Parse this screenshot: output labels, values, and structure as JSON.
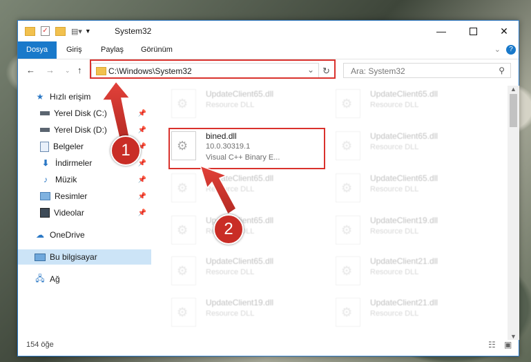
{
  "window": {
    "title": "System32"
  },
  "ribbon": {
    "tabs": [
      "Dosya",
      "Giriş",
      "Paylaş",
      "Görünüm"
    ]
  },
  "address": {
    "path": "C:\\Windows\\System32"
  },
  "search": {
    "placeholder": "Ara: System32"
  },
  "sidebar": {
    "items": [
      {
        "label": "Hızlı erişim",
        "icon": "star-icon"
      },
      {
        "label": "Yerel Disk (C:)",
        "icon": "drive-icon",
        "pinned": true
      },
      {
        "label": "Yerel Disk (D:)",
        "icon": "drive-icon",
        "pinned": true
      },
      {
        "label": "Belgeler",
        "icon": "documents-icon",
        "pinned": true
      },
      {
        "label": "İndirmeler",
        "icon": "download-icon",
        "pinned": true
      },
      {
        "label": "Müzik",
        "icon": "music-icon",
        "pinned": true
      },
      {
        "label": "Resimler",
        "icon": "pictures-icon",
        "pinned": true
      },
      {
        "label": "Videolar",
        "icon": "videos-icon",
        "pinned": true
      },
      {
        "label": "OneDrive",
        "icon": "cloud-icon"
      },
      {
        "label": "Bu bilgisayar",
        "icon": "computer-icon",
        "selected": true
      },
      {
        "label": "Ağ",
        "icon": "network-icon"
      }
    ]
  },
  "files": {
    "left": [
      {
        "name": "UpdateClient65.dll",
        "type": "Resource DLL"
      },
      {
        "name": "bined.dll",
        "version": "10.0.30319.1",
        "type": "Visual C++ Binary E..."
      },
      {
        "name": "UpdateClient65.dll",
        "type": "Resource DLL"
      },
      {
        "name": "UpdateClient65.dll",
        "type": "Resource DLL"
      },
      {
        "name": "UpdateClient65.dll",
        "type": "Resource DLL"
      },
      {
        "name": "UpdateClient19.dll",
        "type": "Resource DLL"
      }
    ],
    "right": [
      {
        "name": "UpdateClient65.dll",
        "type": "Resource DLL"
      },
      {
        "name": "UpdateClient65.dll",
        "type": "Resource DLL"
      },
      {
        "name": "UpdateClient65.dll",
        "type": "Resource DLL"
      },
      {
        "name": "UpdateClient19.dll",
        "type": "Resource DLL"
      },
      {
        "name": "UpdateClient21.dll",
        "type": "Resource DLL"
      },
      {
        "name": "UpdateClient21.dll",
        "type": "Resource DLL"
      }
    ]
  },
  "status": {
    "count": "154 öğe"
  },
  "callouts": [
    "1",
    "2"
  ],
  "colors": {
    "accent": "#1979ca",
    "highlight": "#d9312c",
    "callout": "#c92d26"
  }
}
